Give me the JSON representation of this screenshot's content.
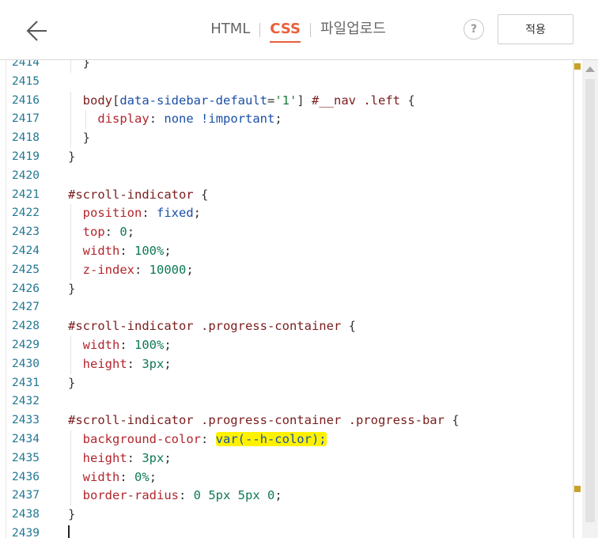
{
  "header": {
    "back_icon": "arrow-left-icon",
    "tabs": [
      {
        "label": "HTML",
        "active": false
      },
      {
        "label": "CSS",
        "active": true
      },
      {
        "label": "파일업로드",
        "active": false
      }
    ],
    "help_label": "?",
    "apply_label": "적용"
  },
  "editor": {
    "lines": [
      {
        "n": "2414",
        "indent": 1,
        "tokens": [
          {
            "t": "}",
            "c": "p"
          }
        ]
      },
      {
        "n": "2415",
        "indent": 0,
        "tokens": []
      },
      {
        "n": "2416",
        "indent": 1,
        "tokens": [
          {
            "t": "body",
            "c": "sel"
          },
          {
            "t": "[",
            "c": "p"
          },
          {
            "t": "data-sidebar-default",
            "c": "attr"
          },
          {
            "t": "=",
            "c": "p"
          },
          {
            "t": "'1'",
            "c": "str"
          },
          {
            "t": "] ",
            "c": "p"
          },
          {
            "t": "#__nav",
            "c": "sel"
          },
          {
            "t": " ",
            "c": "p"
          },
          {
            "t": ".left",
            "c": "sel"
          },
          {
            "t": " {",
            "c": "p"
          }
        ]
      },
      {
        "n": "2417",
        "indent": 2,
        "tokens": [
          {
            "t": "display",
            "c": "prop"
          },
          {
            "t": ": ",
            "c": "p"
          },
          {
            "t": "none",
            "c": "kw"
          },
          {
            "t": " ",
            "c": "p"
          },
          {
            "t": "!important",
            "c": "imp"
          },
          {
            "t": ";",
            "c": "p"
          }
        ]
      },
      {
        "n": "2418",
        "indent": 1,
        "tokens": [
          {
            "t": "}",
            "c": "p"
          }
        ]
      },
      {
        "n": "2419",
        "indent": 0,
        "tokens": [
          {
            "t": "}",
            "c": "p"
          }
        ]
      },
      {
        "n": "2420",
        "indent": 0,
        "tokens": []
      },
      {
        "n": "2421",
        "indent": 0,
        "tokens": [
          {
            "t": "#scroll-indicator",
            "c": "sel"
          },
          {
            "t": " {",
            "c": "p"
          }
        ]
      },
      {
        "n": "2422",
        "indent": 1,
        "tokens": [
          {
            "t": "position",
            "c": "prop"
          },
          {
            "t": ": ",
            "c": "p"
          },
          {
            "t": "fixed",
            "c": "kw"
          },
          {
            "t": ";",
            "c": "p"
          }
        ]
      },
      {
        "n": "2423",
        "indent": 1,
        "tokens": [
          {
            "t": "top",
            "c": "prop"
          },
          {
            "t": ": ",
            "c": "p"
          },
          {
            "t": "0",
            "c": "num"
          },
          {
            "t": ";",
            "c": "p"
          }
        ]
      },
      {
        "n": "2424",
        "indent": 1,
        "tokens": [
          {
            "t": "width",
            "c": "prop"
          },
          {
            "t": ": ",
            "c": "p"
          },
          {
            "t": "100%",
            "c": "num"
          },
          {
            "t": ";",
            "c": "p"
          }
        ]
      },
      {
        "n": "2425",
        "indent": 1,
        "tokens": [
          {
            "t": "z-index",
            "c": "prop"
          },
          {
            "t": ": ",
            "c": "p"
          },
          {
            "t": "10000",
            "c": "num"
          },
          {
            "t": ";",
            "c": "p"
          }
        ]
      },
      {
        "n": "2426",
        "indent": 0,
        "tokens": [
          {
            "t": "}",
            "c": "p"
          }
        ]
      },
      {
        "n": "2427",
        "indent": 0,
        "tokens": []
      },
      {
        "n": "2428",
        "indent": 0,
        "tokens": [
          {
            "t": "#scroll-indicator",
            "c": "sel"
          },
          {
            "t": " ",
            "c": "p"
          },
          {
            "t": ".progress-container",
            "c": "sel"
          },
          {
            "t": " {",
            "c": "p"
          }
        ]
      },
      {
        "n": "2429",
        "indent": 1,
        "tokens": [
          {
            "t": "width",
            "c": "prop"
          },
          {
            "t": ": ",
            "c": "p"
          },
          {
            "t": "100%",
            "c": "num"
          },
          {
            "t": ";",
            "c": "p"
          }
        ]
      },
      {
        "n": "2430",
        "indent": 1,
        "tokens": [
          {
            "t": "height",
            "c": "prop"
          },
          {
            "t": ": ",
            "c": "p"
          },
          {
            "t": "3px",
            "c": "num"
          },
          {
            "t": ";",
            "c": "p"
          }
        ]
      },
      {
        "n": "2431",
        "indent": 0,
        "tokens": [
          {
            "t": "}",
            "c": "p"
          }
        ]
      },
      {
        "n": "2432",
        "indent": 0,
        "tokens": []
      },
      {
        "n": "2433",
        "indent": 0,
        "tokens": [
          {
            "t": "#scroll-indicator",
            "c": "sel"
          },
          {
            "t": " ",
            "c": "p"
          },
          {
            "t": ".progress-container",
            "c": "sel"
          },
          {
            "t": " ",
            "c": "p"
          },
          {
            "t": ".progress-bar",
            "c": "sel"
          },
          {
            "t": " {",
            "c": "p"
          }
        ]
      },
      {
        "n": "2434",
        "indent": 1,
        "tokens": [
          {
            "t": "background-color",
            "c": "prop"
          },
          {
            "t": ": ",
            "c": "p"
          },
          {
            "t": "var(--h-color);",
            "c": "kw",
            "hl": true
          }
        ]
      },
      {
        "n": "2435",
        "indent": 1,
        "tokens": [
          {
            "t": "height",
            "c": "prop"
          },
          {
            "t": ": ",
            "c": "p"
          },
          {
            "t": "3px",
            "c": "num"
          },
          {
            "t": ";",
            "c": "p"
          }
        ]
      },
      {
        "n": "2436",
        "indent": 1,
        "tokens": [
          {
            "t": "width",
            "c": "prop"
          },
          {
            "t": ": ",
            "c": "p"
          },
          {
            "t": "0%",
            "c": "num"
          },
          {
            "t": ";",
            "c": "p"
          }
        ]
      },
      {
        "n": "2437",
        "indent": 1,
        "tokens": [
          {
            "t": "border-radius",
            "c": "prop"
          },
          {
            "t": ": ",
            "c": "p"
          },
          {
            "t": "0 5px 5px 0",
            "c": "num"
          },
          {
            "t": ";",
            "c": "p"
          }
        ]
      },
      {
        "n": "2438",
        "indent": 0,
        "tokens": [
          {
            "t": "}",
            "c": "p"
          }
        ]
      },
      {
        "n": "2439",
        "indent": 0,
        "tokens": [],
        "cursor": true
      }
    ]
  },
  "colors": {
    "accent": "#e8613a",
    "line_number": "#237893",
    "highlight": "#fff200"
  }
}
